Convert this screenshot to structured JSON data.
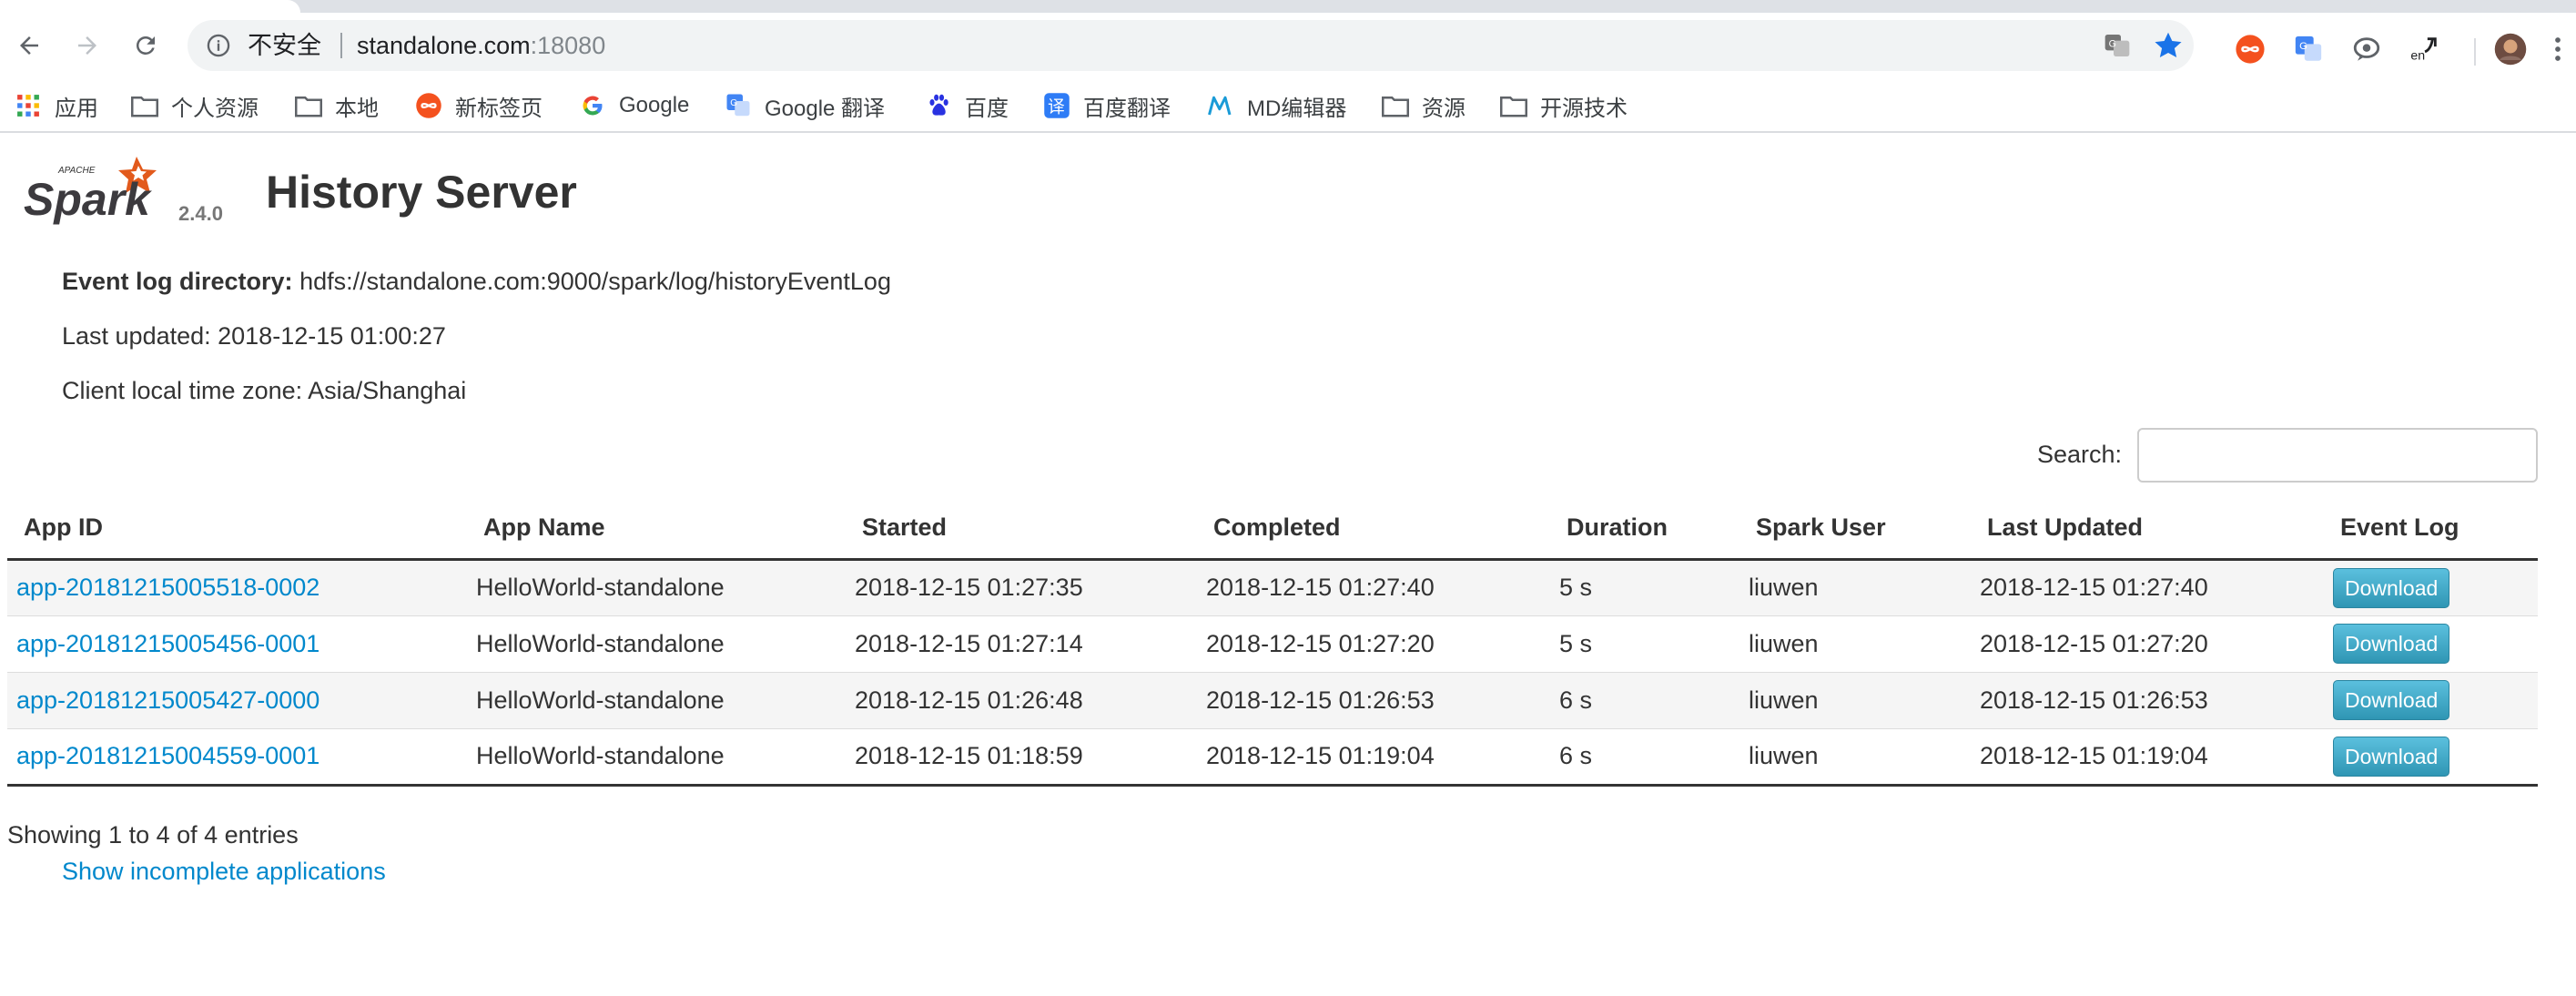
{
  "browser": {
    "security_label": "不安全",
    "url_host": "standalone.com",
    "url_port": ":18080",
    "bookmarks": [
      {
        "label": "应用",
        "icon": "apps-grid-icon"
      },
      {
        "label": "个人资源",
        "icon": "folder-icon"
      },
      {
        "label": "本地",
        "icon": "folder-icon"
      },
      {
        "label": "新标签页",
        "icon": "infinity-icon"
      },
      {
        "label": "Google",
        "icon": "google-icon"
      },
      {
        "label": "Google 翻译",
        "icon": "google-translate-icon"
      },
      {
        "label": "百度",
        "icon": "baidu-icon"
      },
      {
        "label": "百度翻译",
        "icon": "baidu-translate-icon"
      },
      {
        "label": "MD编辑器",
        "icon": "md-editor-icon"
      },
      {
        "label": "资源",
        "icon": "folder-icon"
      },
      {
        "label": "开源技术",
        "icon": "folder-icon"
      }
    ]
  },
  "page": {
    "logo_alt": "Apache Spark",
    "version": "2.4.0",
    "title": "History Server",
    "event_log_label": "Event log directory:",
    "event_log_value": "hdfs://standalone.com:9000/spark/log/historyEventLog",
    "last_updated": "Last updated: 2018-12-15 01:00:27",
    "timezone": "Client local time zone: Asia/Shanghai",
    "search_label": "Search:",
    "search_value": ""
  },
  "table": {
    "headers": [
      "App ID",
      "App Name",
      "Started",
      "Completed",
      "Duration",
      "Spark User",
      "Last Updated",
      "Event Log"
    ],
    "rows": [
      {
        "app_id": "app-20181215005518-0002",
        "app_name": "HelloWorld-standalone",
        "started": "2018-12-15 01:27:35",
        "completed": "2018-12-15 01:27:40",
        "duration": "5 s",
        "user": "liuwen",
        "last_updated": "2018-12-15 01:27:40",
        "event_log": "Download"
      },
      {
        "app_id": "app-20181215005456-0001",
        "app_name": "HelloWorld-standalone",
        "started": "2018-12-15 01:27:14",
        "completed": "2018-12-15 01:27:20",
        "duration": "5 s",
        "user": "liuwen",
        "last_updated": "2018-12-15 01:27:20",
        "event_log": "Download"
      },
      {
        "app_id": "app-20181215005427-0000",
        "app_name": "HelloWorld-standalone",
        "started": "2018-12-15 01:26:48",
        "completed": "2018-12-15 01:26:53",
        "duration": "6 s",
        "user": "liuwen",
        "last_updated": "2018-12-15 01:26:53",
        "event_log": "Download"
      },
      {
        "app_id": "app-20181215004559-0001",
        "app_name": "HelloWorld-standalone",
        "started": "2018-12-15 01:18:59",
        "completed": "2018-12-15 01:19:04",
        "duration": "6 s",
        "user": "liuwen",
        "last_updated": "2018-12-15 01:19:04",
        "event_log": "Download"
      }
    ]
  },
  "footer": {
    "showing": "Showing 1 to 4 of 4 entries",
    "show_incomplete": "Show incomplete applications"
  },
  "colors": {
    "link": "#0088cc",
    "button": "#2f96b4",
    "spark_orange": "#e25a1c",
    "star_blue": "#1a73e8"
  }
}
